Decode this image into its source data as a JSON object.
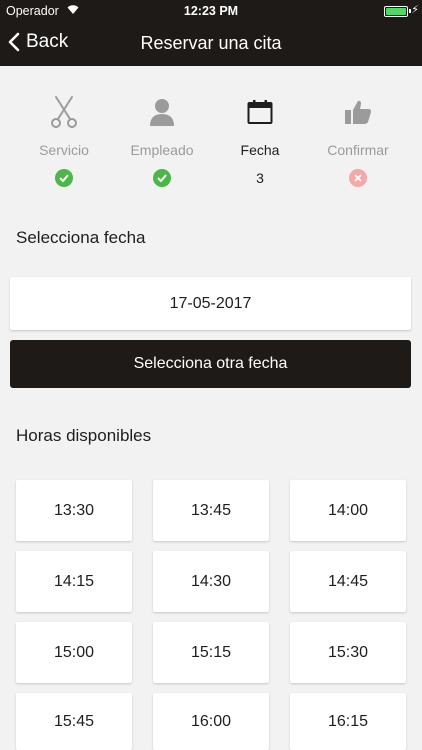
{
  "status_bar": {
    "carrier": "Operador",
    "time": "12:23 PM"
  },
  "nav": {
    "back_label": "Back",
    "title": "Reservar una cita"
  },
  "steps": [
    {
      "label": "Servicio",
      "icon": "scissors-icon",
      "status": "done"
    },
    {
      "label": "Empleado",
      "icon": "person-icon",
      "status": "done"
    },
    {
      "label": "Fecha",
      "icon": "calendar-icon",
      "status": "current",
      "value": "3"
    },
    {
      "label": "Confirmar",
      "icon": "thumbs-up-icon",
      "status": "pending"
    }
  ],
  "date_section": {
    "title": "Selecciona fecha",
    "selected_date": "17-05-2017",
    "change_button": "Selecciona otra fecha"
  },
  "hours_section": {
    "title": "Horas disponibles",
    "slots": [
      "13:30",
      "13:45",
      "14:00",
      "14:15",
      "14:30",
      "14:45",
      "15:00",
      "15:15",
      "15:30",
      "15:45",
      "16:00",
      "16:15"
    ]
  },
  "colors": {
    "header_bg": "#1e1a17",
    "success": "#4cb648",
    "error": "#f4a8a8",
    "background": "#f2f2f2"
  }
}
